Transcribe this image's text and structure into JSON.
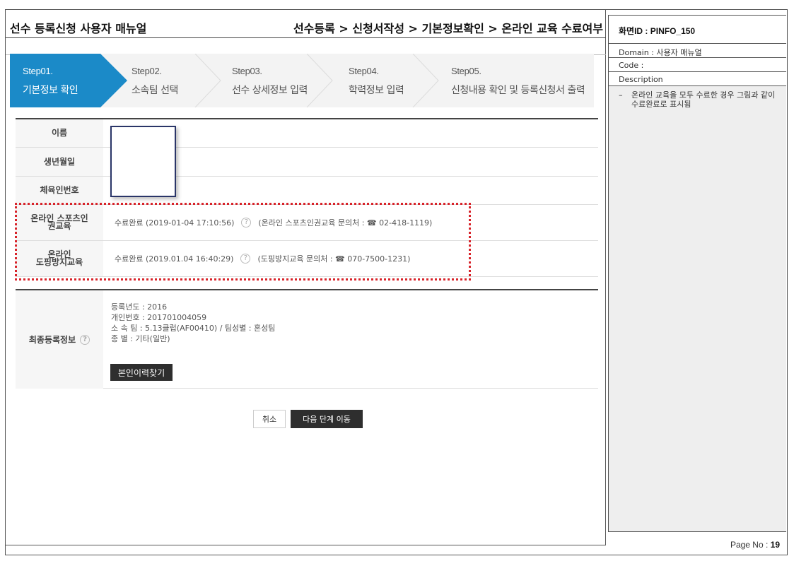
{
  "header": {
    "title": "선수 등록신청 사용자 매뉴얼",
    "breadcrumb": "선수등록 > 신청서작성 > 기본정보확인 > 온라인 교육 수료여부"
  },
  "steps": [
    {
      "num": "Step01.",
      "label": "기본정보 확인",
      "active": true
    },
    {
      "num": "Step02.",
      "label": "소속팀 선택",
      "active": false
    },
    {
      "num": "Step03.",
      "label": "선수 상세정보 입력",
      "active": false
    },
    {
      "num": "Step04.",
      "label": "학력정보 입력",
      "active": false
    },
    {
      "num": "Step05.",
      "label": "신청내용 확인 및 등록신청서 출력",
      "active": false
    }
  ],
  "colors": {
    "step_active": "#1b8ac8",
    "highlight_border": "#d8232a",
    "dark_button": "#2e2e2e"
  },
  "info": {
    "name_label": "이름",
    "birth_label": "생년월일",
    "sports_id_label": "체육인번호",
    "online_human_rights": {
      "label_line1": "온라인 스포츠인",
      "label_line2": "권교육",
      "status": "수료완료 (2019-01-04 17:10:56)",
      "contact_label": "(온라인 스포츠인권교육 문의처 : ☎ 02-418-1119)"
    },
    "online_doping": {
      "label_line1": "온라인",
      "label_line2": "도핑방지교육",
      "status": "수료완료 (2019.01.04 16:40:29)",
      "contact_label": "(도핑방지교육 문의처 : ☎ 070-7500-1231)"
    }
  },
  "final_info": {
    "label": "최종등록정보",
    "lines": [
      "등록년도 : 2016",
      "개인번호 : 201701004059",
      "소 속 팀 : 5.13클럽(AF00410) / 팀성별 : 혼성팀",
      "종      별 : 기타(일반)"
    ],
    "find_history_button": "본인이력찾기"
  },
  "actions": {
    "cancel": "취소",
    "next": "다음 단계 이동"
  },
  "side_panel": {
    "screen_id": "화면ID : PINFO_150",
    "domain": "Domain : 사용자 매뉴얼",
    "code": "Code :",
    "description_label": "Description",
    "description_dash": "–",
    "description_text": "온라인 교육을 모두 수료한 경우 그림과 같이 수료완료로 표시됨",
    "page_label": "Page No : ",
    "page_number": "19"
  }
}
